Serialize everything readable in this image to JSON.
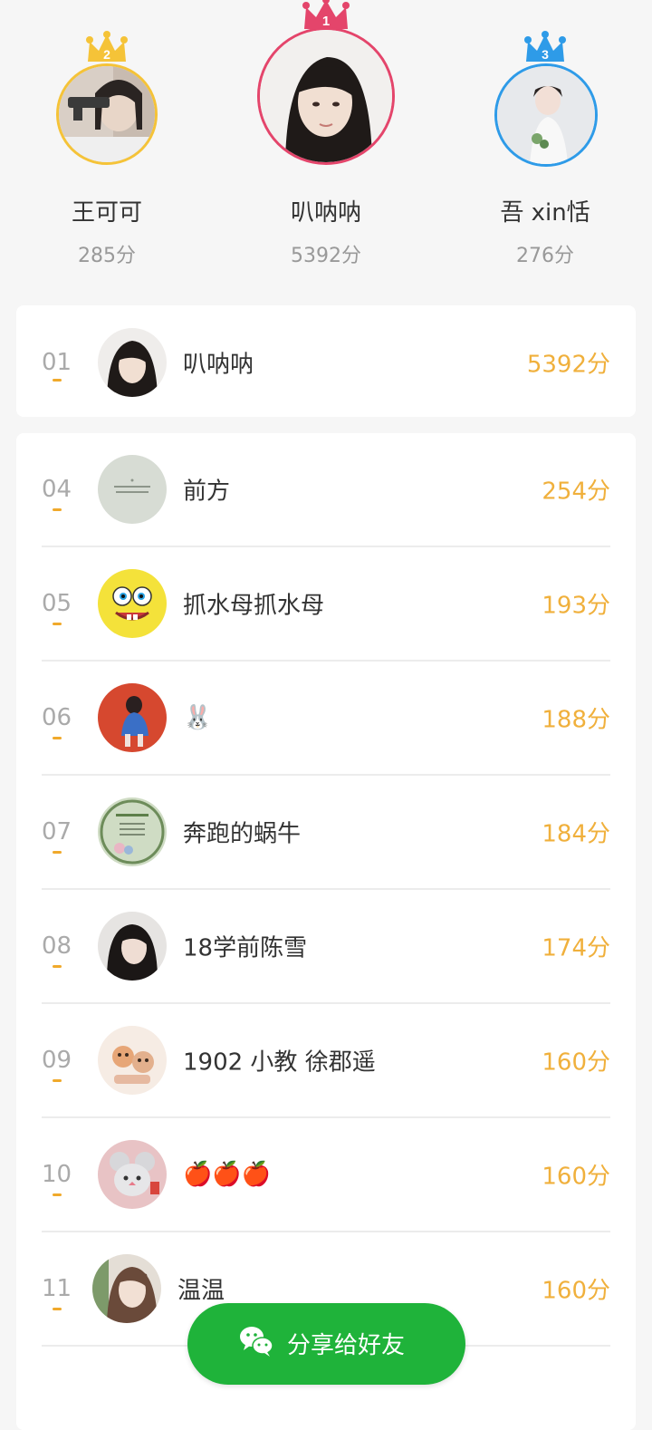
{
  "podium": [
    {
      "rank": "2",
      "name": "王可可",
      "score": "285分"
    },
    {
      "rank": "1",
      "name": "叭呐呐",
      "score": "5392分"
    },
    {
      "rank": "3",
      "name": "吾 xin恬",
      "score": "276分"
    }
  ],
  "my_row": {
    "rank": "01",
    "name": "叭呐呐",
    "score": "5392分"
  },
  "rows": [
    {
      "rank": "04",
      "name": "前方",
      "score": "254分"
    },
    {
      "rank": "05",
      "name": "抓水母抓水母",
      "score": "193分"
    },
    {
      "rank": "06",
      "name": "🐰",
      "score": "188分"
    },
    {
      "rank": "07",
      "name": "奔跑的蜗牛",
      "score": "184分"
    },
    {
      "rank": "08",
      "name": "18学前陈雪",
      "score": "174分"
    },
    {
      "rank": "09",
      "name": "1902 小教 徐郡遥",
      "score": "160分"
    },
    {
      "rank": "10",
      "name": "🍎🍎🍎",
      "score": "160分"
    },
    {
      "rank": "11",
      "name": "温温",
      "score": "160分"
    }
  ],
  "share_button": {
    "label": "分享给好友",
    "icon": "wechat-icon"
  },
  "colors": {
    "gold": "#f5c338",
    "red": "#e4456b",
    "blue": "#2e9be8",
    "score": "#f0b03c",
    "green": "#1fb33a"
  }
}
